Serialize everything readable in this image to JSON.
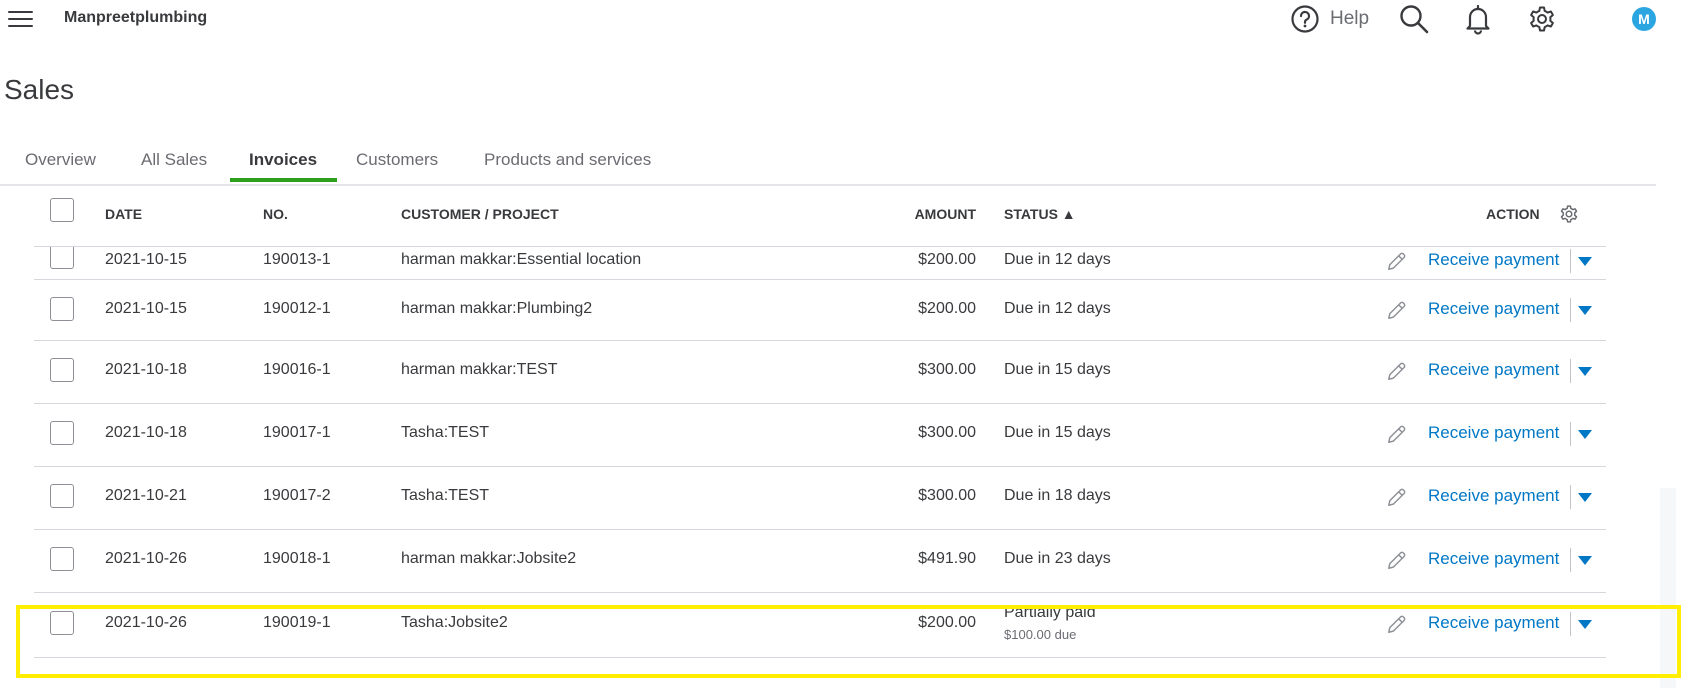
{
  "header": {
    "company": "Manpreetplumbing",
    "help_label": "Help",
    "avatar_initial": "M",
    "icons": [
      "menu-icon",
      "help-icon",
      "search-icon",
      "bell-icon",
      "gear-icon"
    ]
  },
  "page": {
    "title": "Sales"
  },
  "tabs": [
    {
      "label": "Overview",
      "active": false
    },
    {
      "label": "All Sales",
      "active": false
    },
    {
      "label": "Invoices",
      "active": true
    },
    {
      "label": "Customers",
      "active": false
    },
    {
      "label": "Products and services",
      "active": false
    }
  ],
  "table": {
    "columns": {
      "date": "DATE",
      "no": "NO.",
      "customer": "CUSTOMER / PROJECT",
      "amount": "AMOUNT",
      "status": "STATUS ▲",
      "action": "ACTION"
    },
    "rows": [
      {
        "date": "2021-10-15",
        "no": "190013-1",
        "customer": "harman makkar:Essential location",
        "amount": "$200.00",
        "status": "Due in 12 days",
        "status_sub": "",
        "action": "Receive payment"
      },
      {
        "date": "2021-10-15",
        "no": "190012-1",
        "customer": "harman makkar:Plumbing2",
        "amount": "$200.00",
        "status": "Due in 12 days",
        "status_sub": "",
        "action": "Receive payment"
      },
      {
        "date": "2021-10-18",
        "no": "190016-1",
        "customer": "harman makkar:TEST",
        "amount": "$300.00",
        "status": "Due in 15 days",
        "status_sub": "",
        "action": "Receive payment"
      },
      {
        "date": "2021-10-18",
        "no": "190017-1",
        "customer": "Tasha:TEST",
        "amount": "$300.00",
        "status": "Due in 15 days",
        "status_sub": "",
        "action": "Receive payment"
      },
      {
        "date": "2021-10-21",
        "no": "190017-2",
        "customer": "Tasha:TEST",
        "amount": "$300.00",
        "status": "Due in 18 days",
        "status_sub": "",
        "action": "Receive payment"
      },
      {
        "date": "2021-10-26",
        "no": "190018-1",
        "customer": "harman makkar:Jobsite2",
        "amount": "$491.90",
        "status": "Due in 23 days",
        "status_sub": "",
        "action": "Receive payment"
      },
      {
        "date": "2021-10-26",
        "no": "190019-1",
        "customer": "Tasha:Jobsite2",
        "amount": "$200.00",
        "status": "Partially paid",
        "status_sub": "$100.00 due",
        "action": "Receive payment",
        "highlighted": true
      }
    ]
  },
  "colors": {
    "accent_green": "#2ca01c",
    "link_blue": "#0077c5",
    "highlight_yellow": "#ffee00",
    "avatar_blue": "#2ca6e0"
  }
}
